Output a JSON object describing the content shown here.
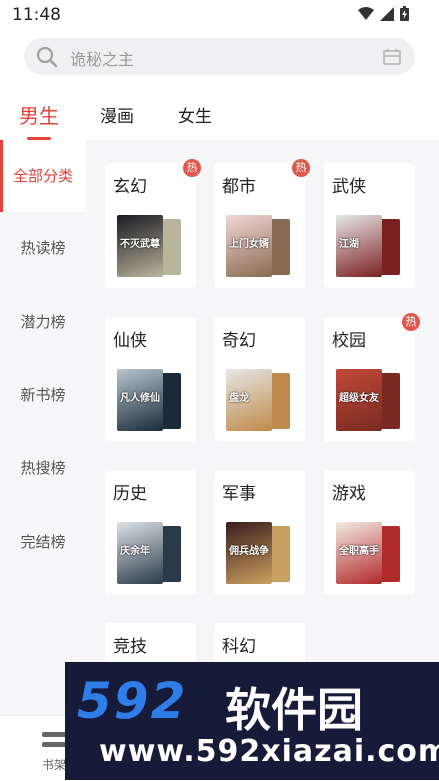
{
  "status": {
    "time": "11:48"
  },
  "search": {
    "placeholder": "诡秘之主"
  },
  "tabs": [
    {
      "label": "男生",
      "active": true
    },
    {
      "label": "漫画",
      "active": false
    },
    {
      "label": "女生",
      "active": false
    }
  ],
  "sidebar": [
    {
      "label": "全部分类",
      "active": true
    },
    {
      "label": "热读榜"
    },
    {
      "label": "潜力榜"
    },
    {
      "label": "新书榜"
    },
    {
      "label": "热搜榜"
    },
    {
      "label": "完结榜"
    }
  ],
  "categories": [
    {
      "label": "玄幻",
      "hot": "热",
      "cover_text": "不灭武尊",
      "c1": "#1a1a22",
      "c2": "#b9b49a"
    },
    {
      "label": "都市",
      "hot": "热",
      "cover_text": "上门女婿",
      "c1": "#f2d6d6",
      "c2": "#8a6a50"
    },
    {
      "label": "武侠",
      "cover_text": "江湖",
      "c1": "#e8e8e8",
      "c2": "#7a2020"
    },
    {
      "label": "仙侠",
      "cover_text": "凡人修仙",
      "c1": "#b8c6d0",
      "c2": "#1a2a38"
    },
    {
      "label": "奇幻",
      "cover_text": "盘龙",
      "c1": "#e6e6e6",
      "c2": "#c08a4a"
    },
    {
      "label": "校园",
      "hot": "热",
      "cover_text": "超级女友",
      "c1": "#c04a3a",
      "c2": "#7a2a20"
    },
    {
      "label": "历史",
      "cover_text": "庆余年",
      "c1": "#dde3e8",
      "c2": "#2a3a48"
    },
    {
      "label": "军事",
      "cover_text": "佣兵战争",
      "c1": "#3a1c1c",
      "c2": "#c9a060"
    },
    {
      "label": "游戏",
      "cover_text": "全职高手",
      "c1": "#f4ece4",
      "c2": "#b02a2a"
    },
    {
      "label": "竞技"
    },
    {
      "label": "科幻"
    }
  ],
  "bottom_nav": {
    "label": "书架"
  },
  "watermark": {
    "brand": "592",
    "brand_cn": "软件园",
    "url": "www.592xiazai.com"
  },
  "colors": {
    "accent": "#e0443a",
    "hot_badge": "#e0574b",
    "watermark_bg": "#171b3a",
    "watermark_blue": "#2f7de8"
  }
}
